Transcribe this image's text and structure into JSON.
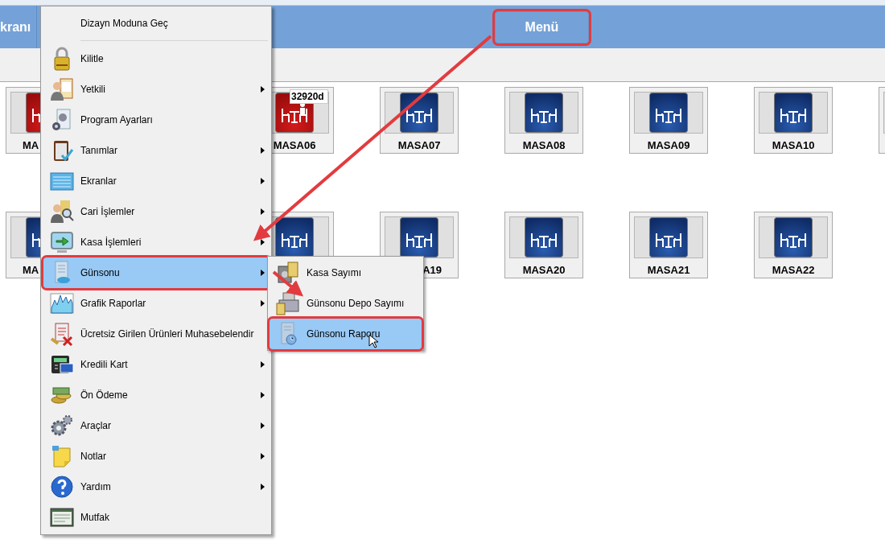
{
  "top_bar": {
    "buttons": [
      {
        "label": "kranı",
        "highlighted": false
      },
      {
        "label": "Menü",
        "highlighted": true
      }
    ]
  },
  "table_rows": [
    {
      "tiles": [
        {
          "kind": "occupied",
          "label": "MA"
        },
        {
          "kind": "occupied",
          "label": "MASA06",
          "badge": "32920d"
        },
        {
          "kind": "empty",
          "label": "MASA07"
        },
        {
          "kind": "empty",
          "label": "MASA08"
        },
        {
          "kind": "empty",
          "label": "MASA09"
        },
        {
          "kind": "empty",
          "label": "MASA10"
        },
        {
          "kind": "empty"
        }
      ]
    },
    {
      "tiles": [
        {
          "kind": "empty",
          "label": "MA"
        },
        {
          "kind": "empty"
        },
        {
          "kind": "empty",
          "label": "A19"
        },
        {
          "kind": "empty",
          "label": "MASA20"
        },
        {
          "kind": "empty",
          "label": "MASA21"
        },
        {
          "kind": "empty",
          "label": "MASA22"
        }
      ]
    }
  ],
  "menu": {
    "items": [
      {
        "kind": "item",
        "label": "Dizayn Moduna Geç",
        "submenu": false,
        "selected": false,
        "highlighted": false
      },
      {
        "kind": "separator"
      },
      {
        "kind": "item",
        "label": "Kilitle",
        "submenu": false,
        "selected": false,
        "highlighted": false
      },
      {
        "kind": "item",
        "label": "Yetkili",
        "submenu": true,
        "selected": false,
        "highlighted": false
      },
      {
        "kind": "item",
        "label": "Program Ayarları",
        "submenu": false,
        "selected": false,
        "highlighted": false
      },
      {
        "kind": "item",
        "label": "Tanımlar",
        "submenu": true,
        "selected": false,
        "highlighted": false
      },
      {
        "kind": "item",
        "label": "Ekranlar",
        "submenu": true,
        "selected": false,
        "highlighted": false
      },
      {
        "kind": "item",
        "label": "Cari İşlemler",
        "submenu": true,
        "selected": false,
        "highlighted": false
      },
      {
        "kind": "item",
        "label": "Kasa İşlemleri",
        "submenu": true,
        "selected": false,
        "highlighted": false
      },
      {
        "kind": "item",
        "label": "Günsonu",
        "submenu": true,
        "selected": true,
        "highlighted": true
      },
      {
        "kind": "item",
        "label": "Grafik Raporlar",
        "submenu": true,
        "selected": false,
        "highlighted": false
      },
      {
        "kind": "item",
        "label": "Ücretsiz Girilen Ürünleri Muhasebelendir",
        "submenu": false,
        "selected": false,
        "highlighted": false
      },
      {
        "kind": "item",
        "label": "Kredili Kart",
        "submenu": true,
        "selected": false,
        "highlighted": false
      },
      {
        "kind": "item",
        "label": "Ön Ödeme",
        "submenu": true,
        "selected": false,
        "highlighted": false
      },
      {
        "kind": "item",
        "label": "Araçlar",
        "submenu": true,
        "selected": false,
        "highlighted": false
      },
      {
        "kind": "item",
        "label": "Notlar",
        "submenu": true,
        "selected": false,
        "highlighted": false
      },
      {
        "kind": "item",
        "label": "Yardım",
        "submenu": true,
        "selected": false,
        "highlighted": false
      },
      {
        "kind": "item",
        "label": "Mutfak",
        "submenu": false,
        "selected": false,
        "highlighted": false
      }
    ]
  },
  "submenu": {
    "items": [
      {
        "label": "Kasa Sayımı",
        "selected": false,
        "highlighted": false
      },
      {
        "label": "Günsonu Depo Sayımı",
        "selected": false,
        "highlighted": false
      },
      {
        "label": "Günsonu Raporu",
        "selected": true,
        "highlighted": true
      }
    ]
  }
}
